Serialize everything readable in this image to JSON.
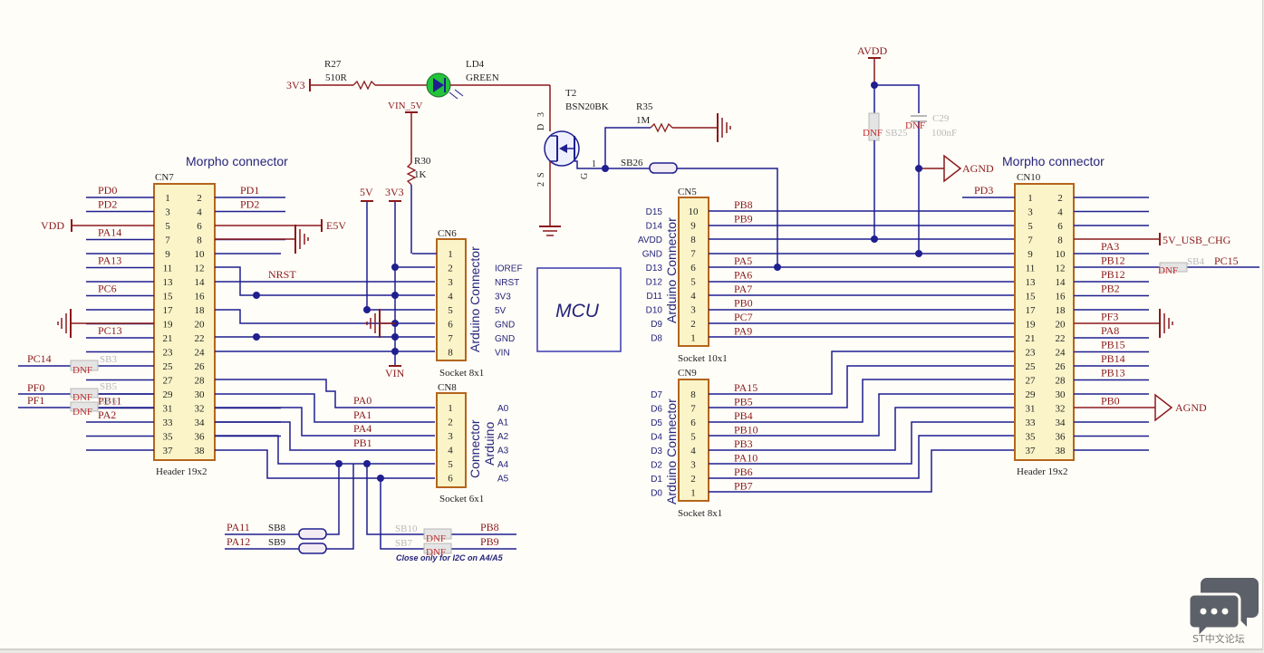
{
  "diagram": {
    "mcu_label": "MCU",
    "morpho_left_title": "Morpho connector",
    "morpho_right_title": "Morpho connector",
    "cn7": {
      "ref": "CN7",
      "footer": "Header 19x2",
      "left_nets": [
        "PD0",
        "PD2",
        "",
        "PA14",
        "",
        "PA13",
        "",
        "PC6",
        "",
        "",
        "PC13",
        "",
        "",
        "",
        "",
        "PB11",
        "PA2",
        "",
        ""
      ],
      "right_nets": [
        "PD1",
        "PD2",
        "E5V",
        "",
        "",
        "",
        "NRST",
        "",
        "",
        "",
        "",
        "",
        "",
        "",
        "",
        "",
        "",
        "",
        ""
      ],
      "vdd": "VDD",
      "pc14": "PC14",
      "pf0": "PF0",
      "pf1": "PF1",
      "sb3": "SB3",
      "sb5": "SB5",
      "sb6": "SB6",
      "dnf": "DNF"
    },
    "cn10": {
      "ref": "CN10",
      "footer": "Header 19x2",
      "left_nets": [
        "PD3"
      ],
      "right_nets": [
        "",
        "",
        "",
        "5V_USB_CHG",
        "PA3",
        "PB12",
        "PB12",
        "PB2",
        "",
        "PF3",
        "PA8",
        "PB15",
        "PB14",
        "PB13",
        "",
        "PB0",
        "",
        "",
        ""
      ],
      "sb4": "SB4",
      "pc15": "PC15",
      "dnf": "DNF",
      "agnd": "AGND"
    },
    "cn6": {
      "ref": "CN6",
      "title": "Arduino Connector",
      "footer": "Socket 8x1",
      "pins": [
        "1",
        "2",
        "3",
        "4",
        "5",
        "6",
        "7",
        "8"
      ],
      "signals": [
        "IOREF",
        "NRST",
        "3V3",
        "5V",
        "GND",
        "GND",
        "VIN"
      ],
      "rails": {
        "v5": "5V",
        "v3v3": "3V3",
        "vin": "VIN"
      }
    },
    "cn8": {
      "ref": "CN8",
      "title_a": "Connector",
      "title_b": "Arduino",
      "footer": "Socket 6x1",
      "pins": [
        "1",
        "2",
        "3",
        "4",
        "5",
        "6"
      ],
      "signals": [
        "A0",
        "A1",
        "A2",
        "A3",
        "A4",
        "A5"
      ],
      "nets": [
        "PA0",
        "PA1",
        "PA4",
        "PB1"
      ]
    },
    "cn5": {
      "ref": "CN5",
      "title": "Arduino Connector",
      "footer": "Socket 10x1",
      "pins": [
        "10",
        "9",
        "8",
        "7",
        "6",
        "5",
        "4",
        "3",
        "2",
        "1"
      ],
      "signals": [
        "D15",
        "D14",
        "AVDD",
        "GND",
        "D13",
        "D12",
        "D11",
        "D10",
        "D9",
        "D8"
      ],
      "nets": [
        "PB8",
        "PB9",
        "",
        "",
        "PA5",
        "PA6",
        "PA7",
        "PB0",
        "PC7",
        "PA9"
      ]
    },
    "cn9": {
      "ref": "CN9",
      "title": "Arduino Connector",
      "footer": "Socket 8x1",
      "pins": [
        "8",
        "7",
        "6",
        "5",
        "4",
        "3",
        "2",
        "1"
      ],
      "signals": [
        "D7",
        "D6",
        "D5",
        "D4",
        "D3",
        "D2",
        "D1",
        "D0"
      ],
      "nets": [
        "PA15",
        "PB5",
        "PB4",
        "PB10",
        "PB3",
        "PA10",
        "PB6",
        "PB7"
      ]
    },
    "solder_bridges": {
      "sb8": "SB8",
      "sb9": "SB9",
      "sb10": "SB10",
      "sb7": "SB7",
      "pa11": "PA11",
      "pa12": "PA12",
      "pb8": "PB8",
      "pb9": "PB9",
      "dnf": "DNF",
      "note": "Close only for I2C on A4/A5"
    },
    "led_circuit": {
      "r27": "R27",
      "r27_val": "510R",
      "v3v3": "3V3",
      "ld4": "LD4",
      "ld4_val": "GREEN",
      "vin_5v": "VIN_5V",
      "r30": "R30",
      "r30_val": "1K",
      "t2": "T2",
      "t2_val": "BSN20BK",
      "r35": "R35",
      "r35_val": "1M",
      "sb26": "SB26",
      "pin_d": "D",
      "pin_d_num": "3",
      "pin_s": "S",
      "pin_s_num": "2",
      "pin_g": "G",
      "pin_g_num": "1"
    },
    "avdd_circuit": {
      "avdd": "AVDD",
      "sb25": "SB25",
      "c29": "C29",
      "c29_val": "100nF",
      "dnf": "DNF",
      "agnd": "AGND"
    }
  },
  "colors": {
    "wire": "#1f1f8f",
    "pin_text": "#222222",
    "net_text": "#8b1a1a",
    "body_fill": "#fbf4c8",
    "body_border": "#b5651d",
    "title_text": "#24247a",
    "dnf_text": "#c0302e",
    "dnf_part": "#b9b9b9"
  },
  "watermark": {
    "label": "ST中文论坛",
    "icon": "chat-bubbles-icon"
  }
}
